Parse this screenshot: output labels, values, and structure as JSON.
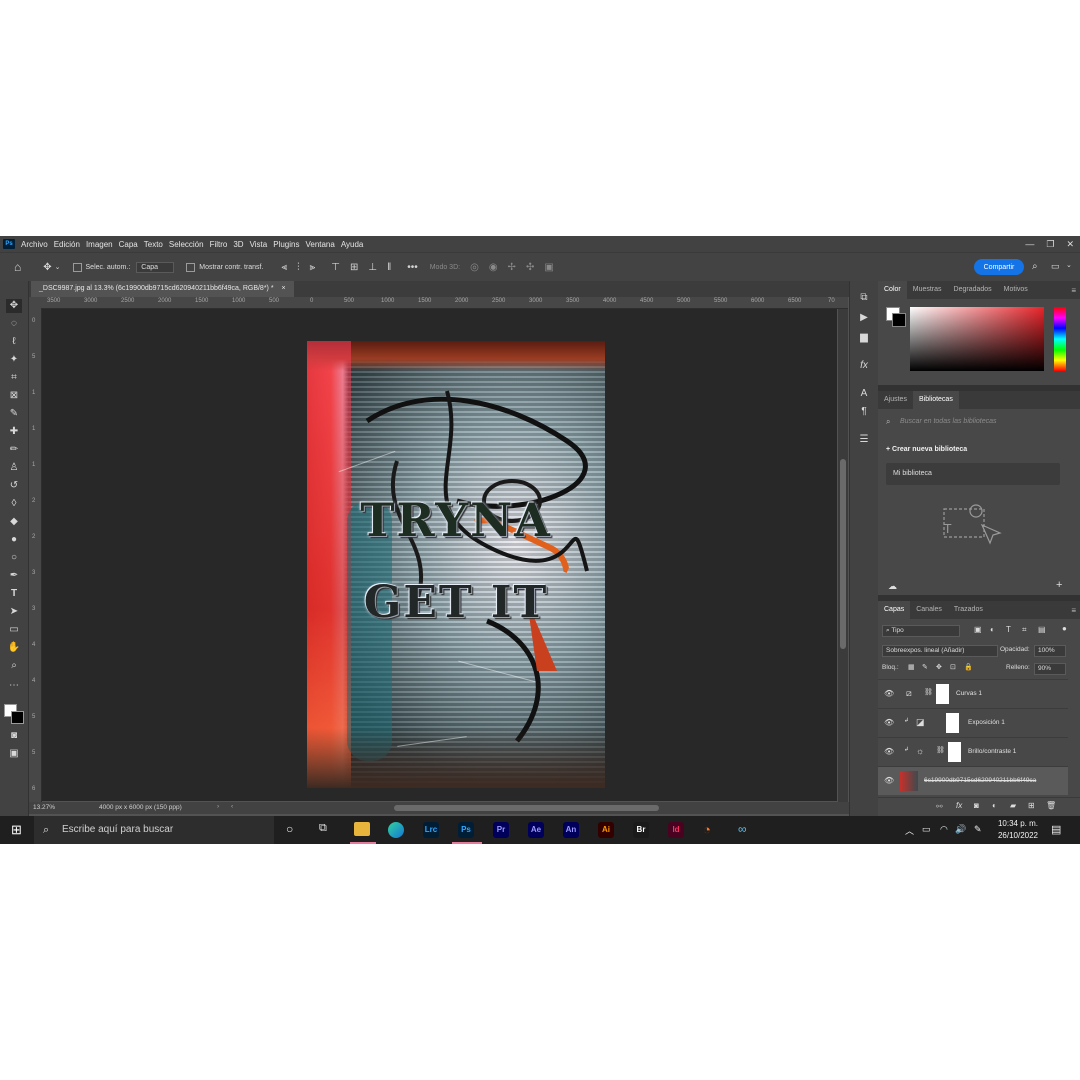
{
  "menubar": {
    "items": [
      "Archivo",
      "Edición",
      "Imagen",
      "Capa",
      "Texto",
      "Selección",
      "Filtro",
      "3D",
      "Vista",
      "Plugins",
      "Ventana",
      "Ayuda"
    ]
  },
  "options_bar": {
    "auto_select_label": "Selec. autom.:",
    "auto_select_value": "Capa",
    "show_transform_label": "Mostrar contr. transf.",
    "mode3d_label": "Modo 3D:",
    "share_label": "Compartir",
    "more_icon": "•••"
  },
  "document": {
    "tab_title": "_DSC9987.jpg al 13.3% (6c19900db9715cd620940211bb6f49ca, RGB/8*) *",
    "close_icon": "×",
    "ruler_h": [
      "3500",
      "3000",
      "2500",
      "2000",
      "1500",
      "1000",
      "500",
      "0",
      "500",
      "1000",
      "1500",
      "2000",
      "2500",
      "3000",
      "3500",
      "4000",
      "4500",
      "5000",
      "5500",
      "6000",
      "6500",
      "70"
    ],
    "ruler_v": [
      "0",
      "5",
      "1",
      "1",
      "1",
      "2",
      "2",
      "3",
      "3",
      "4",
      "4",
      "5",
      "5",
      "6"
    ],
    "canvas_text": [
      "TRYNA",
      "GET IT"
    ],
    "zoom": "13.27%",
    "doc_info": "4000 px x 6000 px (150 ppp)"
  },
  "color_panel": {
    "tabs": [
      "Color",
      "Muestras",
      "Degradados",
      "Motivos"
    ],
    "foreground": "#ffffff",
    "background": "#000000",
    "hue_color": "#e8242a"
  },
  "libraries_panel": {
    "tabs": [
      "Ajustes",
      "Bibliotecas"
    ],
    "search_placeholder": "Buscar en todas las bibliotecas",
    "create_label": "Crear nueva biblioteca",
    "library_name": "Mi biblioteca"
  },
  "layers_panel": {
    "tabs": [
      "Capas",
      "Canales",
      "Trazados"
    ],
    "filter_label": "Tipo",
    "blend_mode": "Sobreexpos. lineal (Añadir)",
    "opacity_label": "Opacidad:",
    "opacity_value": "100%",
    "lock_label": "Bloq.:",
    "fill_label": "Relleno:",
    "fill_value": "90%",
    "layers": [
      {
        "name": "Curvas 1"
      },
      {
        "name": "Exposición 1"
      },
      {
        "name": "Brillo/contraste 1"
      },
      {
        "name": "6c19900db9715cd620940211bb6f49ca"
      }
    ]
  },
  "taskbar": {
    "search_placeholder": "Escribe aquí para buscar",
    "apps": [
      {
        "label": "Lrc",
        "color": "#001d34",
        "text_color": "#31a8ff"
      },
      {
        "label": "Ps",
        "color": "#001e36",
        "text_color": "#31a8ff"
      },
      {
        "label": "Pr",
        "color": "#00005b",
        "text_color": "#9999ff"
      },
      {
        "label": "Ae",
        "color": "#00005b",
        "text_color": "#9999ff"
      },
      {
        "label": "An",
        "color": "#00005b",
        "text_color": "#9999ff"
      },
      {
        "label": "Ai",
        "color": "#330000",
        "text_color": "#ff9a00"
      },
      {
        "label": "Br",
        "color": "#1a1a1a",
        "text_color": "#ffffff"
      },
      {
        "label": "Id",
        "color": "#49021f",
        "text_color": "#ff3366"
      }
    ],
    "time": "10:34 p. m.",
    "date": "26/10/2022"
  }
}
